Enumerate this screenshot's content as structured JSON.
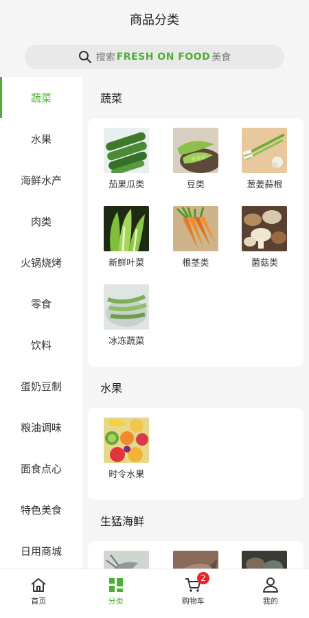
{
  "header": {
    "title": "商品分类"
  },
  "search": {
    "prefix": "搜索",
    "brand": "FRESH ON FOOD",
    "suffix": "美食"
  },
  "sidebar": {
    "active_index": 0,
    "items": [
      {
        "label": "蔬菜"
      },
      {
        "label": "水果"
      },
      {
        "label": "海鲜水产"
      },
      {
        "label": "肉类"
      },
      {
        "label": "火锅烧烤"
      },
      {
        "label": "零食"
      },
      {
        "label": "饮料"
      },
      {
        "label": "蛋奶豆制"
      },
      {
        "label": "粮油调味"
      },
      {
        "label": "面食点心"
      },
      {
        "label": "特色美食"
      },
      {
        "label": "日用商城"
      }
    ]
  },
  "sections": [
    {
      "title": "蔬菜",
      "items": [
        {
          "label": "茄果瓜类",
          "image": "cucumbers"
        },
        {
          "label": "豆类",
          "image": "peas"
        },
        {
          "label": "葱姜蒜根",
          "image": "scallions-garlic"
        },
        {
          "label": "新鲜叶菜",
          "image": "leafy-greens"
        },
        {
          "label": "根茎类",
          "image": "carrots"
        },
        {
          "label": "菌菇类",
          "image": "mushrooms"
        },
        {
          "label": "冰冻蔬菜",
          "image": "frozen-beans"
        }
      ]
    },
    {
      "title": "水果",
      "items": [
        {
          "label": "时令水果",
          "image": "fruit-assortment"
        }
      ]
    },
    {
      "title": "生猛海鲜",
      "items": [
        {
          "label": "",
          "image": "shrimp"
        },
        {
          "label": "",
          "image": "fish"
        },
        {
          "label": "",
          "image": "seafood-platter"
        }
      ]
    }
  ],
  "tabbar": {
    "items": [
      {
        "label": "首页",
        "icon": "home-icon"
      },
      {
        "label": "分类",
        "icon": "category-grid-icon"
      },
      {
        "label": "购物车",
        "icon": "cart-icon",
        "badge": "2"
      },
      {
        "label": "我的",
        "icon": "user-icon"
      }
    ],
    "active_index": 1
  },
  "colors": {
    "accent": "#4cae32",
    "badge": "#e4262b"
  }
}
